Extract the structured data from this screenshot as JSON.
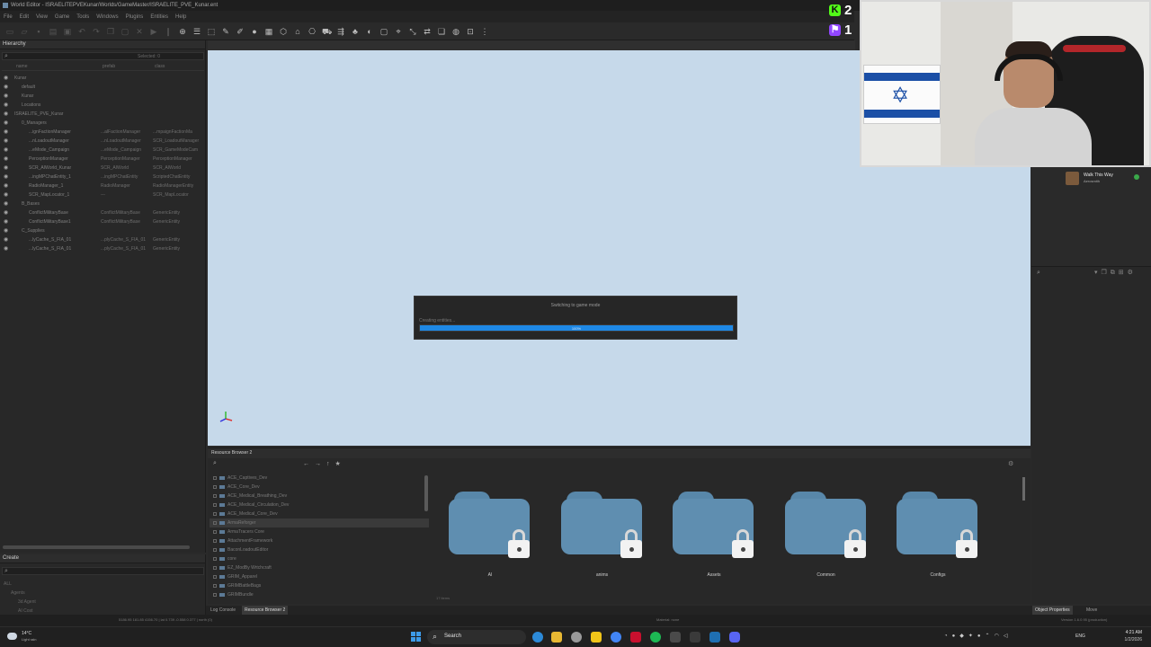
{
  "window": {
    "title": "World Editor - ISRAELITEPVEKunar/Worlds/GameMaster/ISRAELITE_PVE_Kunar.ent"
  },
  "menu": [
    "File",
    "Edit",
    "View",
    "Game",
    "Tools",
    "Windows",
    "Plugins",
    "Entities",
    "Help"
  ],
  "hierarchy": {
    "title": "Hierarchy",
    "selected_label": "Selected: 0",
    "columns": {
      "name": "name",
      "prefab": "prefab",
      "class": "class"
    },
    "rows": [
      {
        "indent": 0,
        "name": "Kunar",
        "prefab": "",
        "class": ""
      },
      {
        "indent": 1,
        "name": "default",
        "prefab": "",
        "class": ""
      },
      {
        "indent": 1,
        "name": "Kunar",
        "prefab": "",
        "class": ""
      },
      {
        "indent": 1,
        "name": "Locations",
        "prefab": "",
        "class": ""
      },
      {
        "indent": 0,
        "name": "ISRAELITE_PVE_Kunar",
        "prefab": "",
        "class": ""
      },
      {
        "indent": 1,
        "name": "0_Managers",
        "prefab": "",
        "class": ""
      },
      {
        "indent": 2,
        "name": "...ignFactionManager",
        "prefab": "...alFactionManager",
        "class": "...mpaignFactionMa"
      },
      {
        "indent": 2,
        "name": "...nLoadoutManager",
        "prefab": "...nLoadoutManager",
        "class": "SCR_LoadoutManager"
      },
      {
        "indent": 2,
        "name": "...eMode_Campaign",
        "prefab": "...eMode_Campaign",
        "class": "SCR_GameModeCam"
      },
      {
        "indent": 2,
        "name": "PerceptionManager",
        "prefab": "PerceptionManager",
        "class": "PerceptionManager"
      },
      {
        "indent": 2,
        "name": "SCR_AIWorld_Kunar",
        "prefab": "SCR_AIWorld",
        "class": "SCR_AIWorld"
      },
      {
        "indent": 2,
        "name": "...ingMPChatEntity_1",
        "prefab": "...ingMPChatEntity",
        "class": "ScriptedChatEntity"
      },
      {
        "indent": 2,
        "name": "RadioManager_1",
        "prefab": "RadioManager",
        "class": "RadioManagerEntity"
      },
      {
        "indent": 2,
        "name": "SCR_MapLocator_1",
        "prefab": "---",
        "class": "SCR_MapLocator"
      },
      {
        "indent": 1,
        "name": "B_Bases",
        "prefab": "",
        "class": ""
      },
      {
        "indent": 2,
        "name": "ConflictMilitaryBase",
        "prefab": "ConflictMilitaryBase",
        "class": "GenericEntity"
      },
      {
        "indent": 2,
        "name": "ConflictMilitaryBase1",
        "prefab": "ConflictMilitaryBase",
        "class": "GenericEntity"
      },
      {
        "indent": 1,
        "name": "C_Supplies",
        "prefab": "",
        "class": ""
      },
      {
        "indent": 2,
        "name": "...lyCache_S_FIA_01",
        "prefab": "...plyCache_S_FIA_01",
        "class": "GenericEntity"
      },
      {
        "indent": 2,
        "name": "...lyCache_S_FIA_01",
        "prefab": "...plyCache_S_FIA_01",
        "class": "GenericEntity"
      }
    ]
  },
  "create_panel": {
    "title": "Create",
    "items": [
      "ALL",
      "Agents",
      "3d Agent",
      "AI Cost"
    ]
  },
  "viewport": {
    "loading_title": "Switching to game mode",
    "loading_status": "Creating entities...",
    "progress_label": "100%",
    "progress": 1.0,
    "background_color": "#c6d9ea",
    "progress_color": "#1e88e5"
  },
  "stream": {
    "kick_icon": "kick-icon",
    "kick_count": "2",
    "kick_color": "#53fc18",
    "twitch_icon": "twitch-icon",
    "twitch_count": "1",
    "twitch_color": "#9146ff",
    "notification_title": "Walk This Way",
    "notification_sub": "Aerosmith"
  },
  "resource_browser": {
    "title": "Resource Browser 2",
    "tree": [
      "ACE_Captives_Dev",
      "ACE_Core_Dev",
      "ACE_Medical_Breathing_Dev",
      "ACE_Medical_Circulation_Dev",
      "ACE_Medical_Core_Dev",
      "ArmaReforger",
      "ArmaTracers Core",
      "AttachmentFramework",
      "BaconLoadoutEditor",
      "core",
      "EZ_ModBy Wrtchcraft",
      "GRIM_Apparel",
      "GRIMBattleBags",
      "GRIMBundle"
    ],
    "selected_index": 5,
    "folders": [
      "AI",
      "anims",
      "Assets",
      "Common",
      "Configs"
    ],
    "item_count": "17 items"
  },
  "bottom_tabs": {
    "log_console": "Log Console",
    "resource_browser": "Resource Browser 2",
    "object_properties": "Object Properties",
    "move": "Move"
  },
  "status": {
    "coords": "5186.95  181.85  4156.70  |  lat 0.739  -0.558  0.377  |  north (0)",
    "material": "Material: none",
    "version": "Version 1.6.0.95 (production)"
  },
  "taskbar": {
    "weather_temp": "14°C",
    "weather_desc": "Light rain",
    "search": "Search",
    "lang": "ENG",
    "time": "4:21 AM",
    "date": "1/2/2026"
  }
}
